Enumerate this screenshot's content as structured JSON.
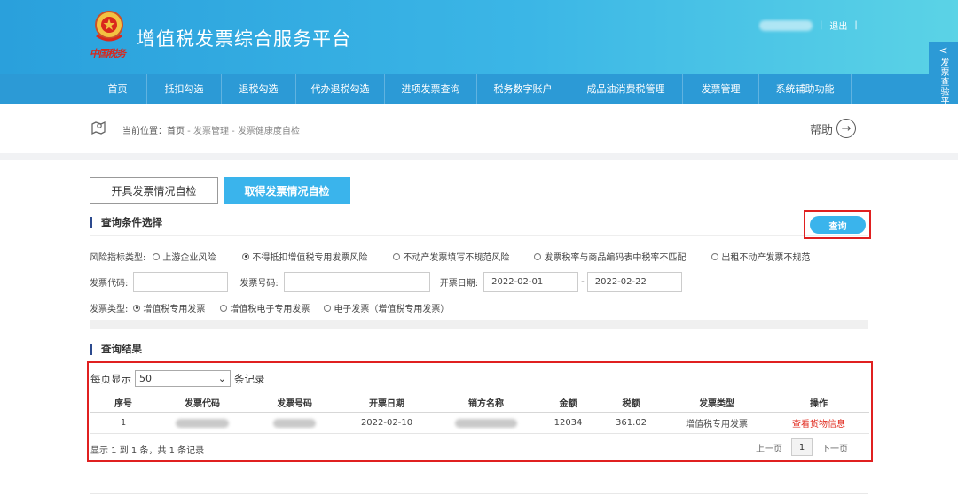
{
  "header": {
    "title": "增值税发票综合服务平台",
    "emblem_text": "中国税务",
    "logout": "退出",
    "separator": "|"
  },
  "nav": [
    {
      "label": "首页",
      "w": 66
    },
    {
      "label": "抵扣勾选",
      "w": 84
    },
    {
      "label": "退税勾选",
      "w": 84
    },
    {
      "label": "代办退税勾选",
      "w": 100
    },
    {
      "label": "进项发票查询",
      "w": 104
    },
    {
      "label": "税务数字账户",
      "w": 104
    },
    {
      "label": "成品油消费税管理",
      "w": 128
    },
    {
      "label": "发票管理",
      "w": 86
    },
    {
      "label": "系统辅助功能",
      "w": 104
    }
  ],
  "side_tab": {
    "arrow": "<",
    "text": "发票查验平台"
  },
  "breadcrumb": {
    "prefix": "当前位置：",
    "home": "首页",
    "sep1": " - ",
    "level1": "发票管理",
    "sep2": " - ",
    "level2": "发票健康度自检"
  },
  "help": {
    "label": "帮助",
    "arrow": "→"
  },
  "tabs": {
    "issue": "开具发票情况自检",
    "receive": "取得发票情况自检"
  },
  "query": {
    "section_title": "查询条件选择",
    "button": "查询",
    "risk_label": "风险指标类型:",
    "risk_options": [
      {
        "label": "上游企业风险",
        "checked": false
      },
      {
        "label": "不得抵扣增值税专用发票风险",
        "checked": true
      },
      {
        "label": "不动产发票填写不规范风险",
        "checked": false
      },
      {
        "label": "发票税率与商品编码表中税率不匹配",
        "checked": false
      },
      {
        "label": "出租不动产发票不规范",
        "checked": false
      }
    ],
    "code_label": "发票代码:",
    "number_label": "发票号码:",
    "date_label": "开票日期:",
    "date_from": "2022-02-01",
    "date_sep": "-",
    "date_to": "2022-02-22",
    "type_label": "发票类型:",
    "type_options": [
      {
        "label": "增值税专用发票",
        "checked": true
      },
      {
        "label": "增值税电子专用发票",
        "checked": false
      },
      {
        "label": "电子发票（增值税专用发票）",
        "checked": false
      }
    ]
  },
  "results": {
    "section_title": "查询结果",
    "page_size_prefix": "每页显示",
    "page_size_value": "50",
    "page_size_suffix": "条记录",
    "columns": [
      "序号",
      "发票代码",
      "发票号码",
      "开票日期",
      "销方名称",
      "金额",
      "税额",
      "发票类型",
      "操作"
    ],
    "rows": [
      {
        "index": "1",
        "date": "2022-02-10",
        "amount": "12034",
        "tax": "361.02",
        "type": "增值税专用发票",
        "action": "查看货物信息"
      }
    ],
    "summary": "显示 1 到 1 条，共 1 条记录",
    "prev": "上一页",
    "page": "1",
    "next": "下一页"
  }
}
